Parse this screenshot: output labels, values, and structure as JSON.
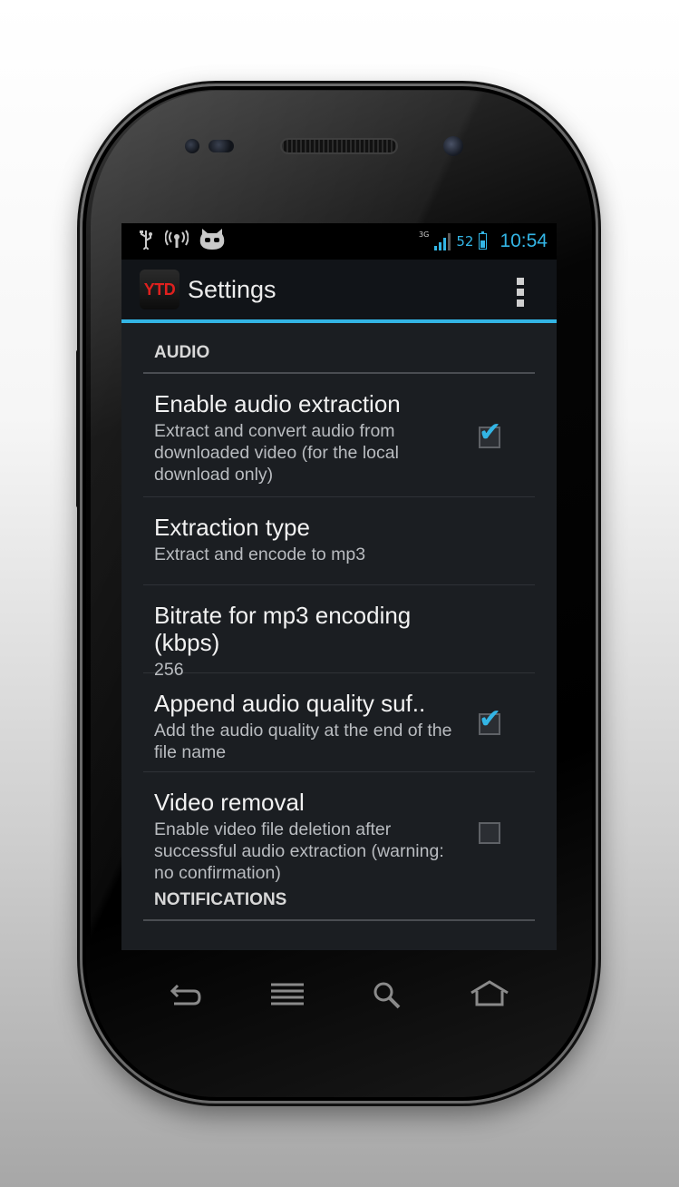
{
  "status_bar": {
    "icons_left": [
      "usb-icon",
      "wireless-icon",
      "cyanogen-mascot-icon"
    ],
    "network_type": "3G",
    "battery_percent": "52",
    "time": "10:54",
    "accent_color": "#33b5e5"
  },
  "action_bar": {
    "app_icon_text": "YTD",
    "title": "Settings"
  },
  "sections": [
    {
      "category": "AUDIO",
      "prefs": [
        {
          "title": "Enable audio extraction",
          "summary": "Extract and convert audio from downloaded video (for the local download only)",
          "checkbox": true,
          "checked": true
        },
        {
          "title": "Extraction type",
          "summary": "Extract and encode to mp3",
          "checkbox": false
        },
        {
          "title": "Bitrate for mp3 encoding (kbps)",
          "summary": "256",
          "checkbox": false
        },
        {
          "title": "Append audio quality suf..",
          "summary": "Add the audio quality at the end of the file name",
          "checkbox": true,
          "checked": true
        },
        {
          "title": "Video removal",
          "summary": "Enable video file deletion after successful audio extraction (warning: no confirmation)",
          "checkbox": true,
          "checked": false
        }
      ]
    },
    {
      "category": "NOTIFICATIONS",
      "prefs": []
    }
  ],
  "nav_keys": [
    "back-icon",
    "menu-icon",
    "search-icon",
    "home-icon"
  ]
}
